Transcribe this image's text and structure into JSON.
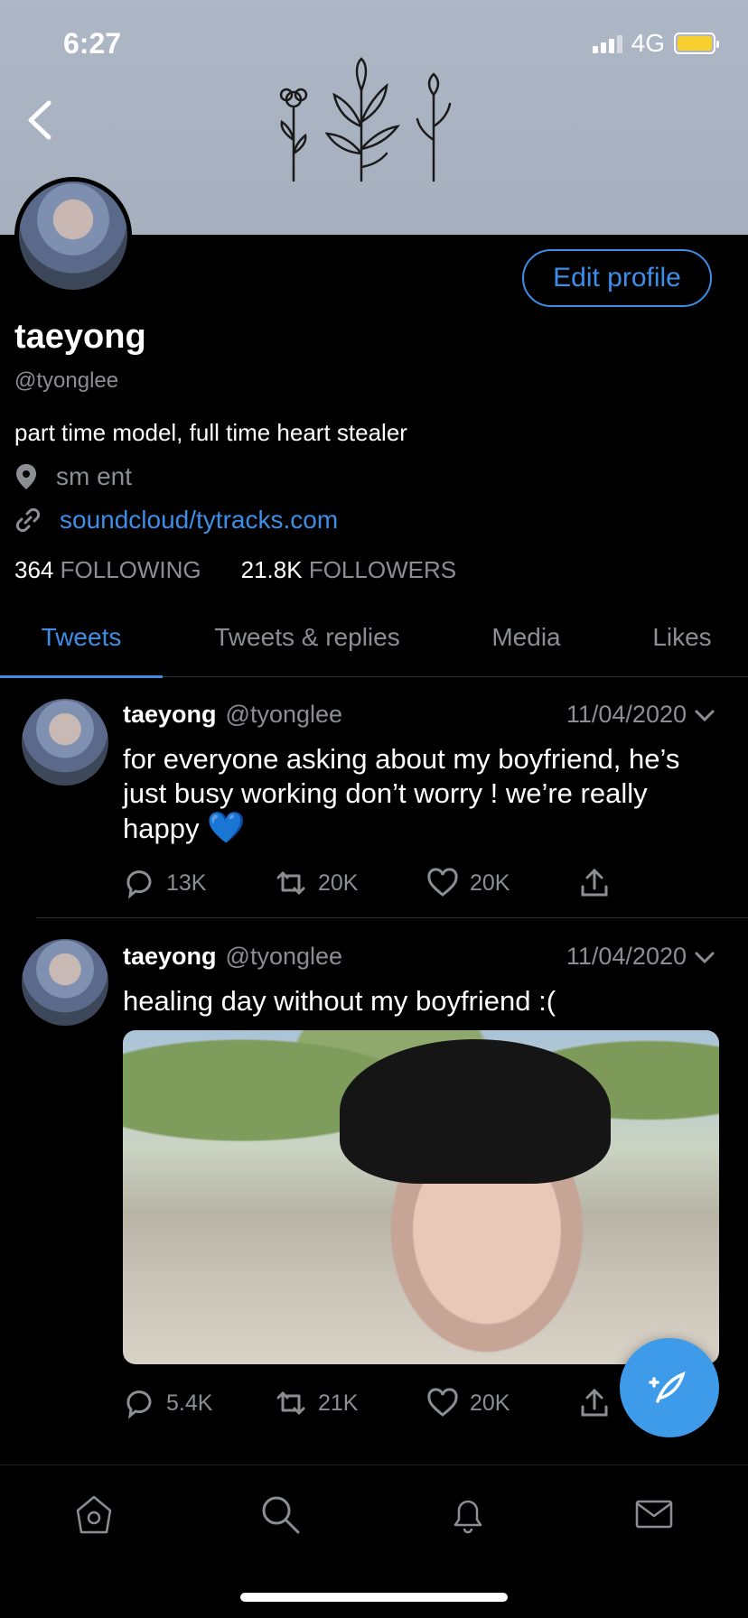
{
  "status_bar": {
    "time": "6:27",
    "network": "4G"
  },
  "profile": {
    "edit_label": "Edit profile",
    "name": "taeyong",
    "handle": "@tyonglee",
    "bio": "part time model, full time heart stealer",
    "location": "sm ent",
    "website": "soundcloud/tytracks.com",
    "following_count": "364",
    "following_label": "FOLLOWING",
    "followers_count": "21.8K",
    "followers_label": "FOLLOWERS"
  },
  "tabs": [
    {
      "label": "Tweets",
      "active": true
    },
    {
      "label": "Tweets & replies",
      "active": false
    },
    {
      "label": "Media",
      "active": false
    },
    {
      "label": "Likes",
      "active": false
    }
  ],
  "tweets": [
    {
      "name": "taeyong",
      "handle": "@tyonglee",
      "date": "11/04/2020",
      "text": "for everyone asking about my boyfriend, he’s just busy working don’t worry ! we’re really happy",
      "emoji": "💙",
      "replies": "13K",
      "retweets": "20K",
      "likes": "20K"
    },
    {
      "name": "taeyong",
      "handle": "@tyonglee",
      "date": "11/04/2020",
      "text": "healing day without my boyfriend :(",
      "replies": "5.4K",
      "retweets": "21K",
      "likes": "20K"
    }
  ],
  "colors": {
    "accent": "#3d8ee8",
    "background": "#000000",
    "muted": "#8b8f94"
  },
  "icons": [
    "back-icon",
    "location-pin-icon",
    "link-icon",
    "chevron-down-icon",
    "reply-icon",
    "retweet-icon",
    "like-icon",
    "share-icon",
    "compose-icon",
    "home-icon",
    "search-icon",
    "notifications-icon",
    "messages-icon"
  ]
}
